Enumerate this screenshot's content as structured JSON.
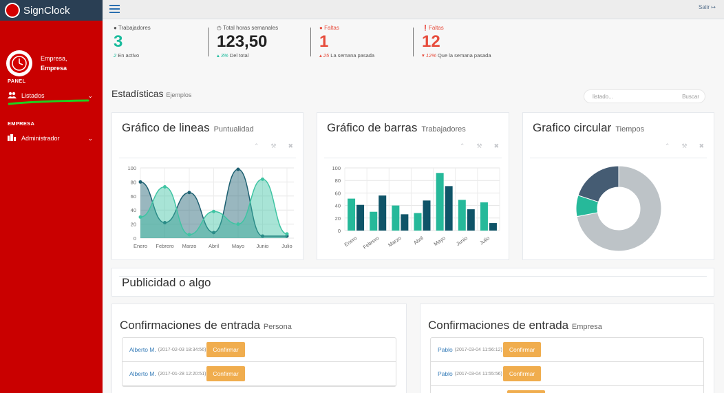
{
  "app": {
    "name": "SignClock"
  },
  "topbar": {
    "logout": "Salir"
  },
  "profile": {
    "greeting": "Empresa,",
    "name": "Empresa"
  },
  "sidebar": {
    "section_panel": "PANEL",
    "section_empresa": "EMPRESA",
    "items": [
      {
        "label": "Listados",
        "icon": "users-icon"
      },
      {
        "label": "Administrador",
        "icon": "building-icon"
      }
    ]
  },
  "stats": [
    {
      "label": "Trabajadores",
      "value": "3",
      "sub_value": "2",
      "sub_text": "En activo",
      "icon": "user-icon",
      "color": "#1abb9c"
    },
    {
      "label": "Total horas semanales",
      "value": "123,50",
      "sub_value": "3%",
      "sub_text": "Del total",
      "icon": "clock-icon",
      "color": "#222222"
    },
    {
      "label": "Faltas",
      "value": "1",
      "sub_value": "25",
      "sub_text": "La semana pasada",
      "icon": "user-icon",
      "color": "#e74c3c"
    },
    {
      "label": "Faltas",
      "value": "12",
      "sub_value": "12%",
      "sub_text": "Que la semana pasada",
      "icon": "exclamation-icon",
      "color": "#e74c3c"
    }
  ],
  "section": {
    "title": "Estadísticas",
    "subtitle": "Ejemplos"
  },
  "search": {
    "placeholder": "listado...",
    "button": "Buscar"
  },
  "panels": {
    "line": {
      "title": "Gráfico de lineas",
      "subtitle": "Puntualidad"
    },
    "bar": {
      "title": "Gráfico de barras",
      "subtitle": "Trabajadores"
    },
    "pie": {
      "title": "Grafico circular",
      "subtitle": "Tiempos"
    }
  },
  "ad": {
    "title": "Publicidad o algo"
  },
  "confirm_person": {
    "title": "Confirmaciones de entrada",
    "subtitle": "Persona",
    "rows": [
      {
        "name": "Alberto M.",
        "date": "(2017-02-03 18:34:56)",
        "button": "Confirmar"
      },
      {
        "name": "Alberto M.",
        "date": "(2017-01-28 12:20:51)",
        "button": "Confirmar"
      }
    ]
  },
  "confirm_company": {
    "title": "Confirmaciones de entrada",
    "subtitle": "Empresa",
    "rows": [
      {
        "name": "Pablo",
        "date": "(2017-03-04 11:56:12)",
        "button": "Confirmar"
      },
      {
        "name": "Pablo",
        "date": "(2017-03-04 11:55:56)",
        "button": "Confirmar"
      }
    ]
  },
  "chart_data": [
    {
      "type": "area",
      "categories": [
        "Enero",
        "Febrero",
        "Marzo",
        "Abril",
        "Mayo",
        "Junio",
        "Julio"
      ],
      "series": [
        {
          "values": [
            80,
            22,
            65,
            8,
            98,
            3,
            3
          ],
          "color": "#1d6071"
        },
        {
          "values": [
            30,
            73,
            5,
            38,
            20,
            84,
            6
          ],
          "color": "#3fc4a3"
        }
      ],
      "ylim": [
        0,
        100
      ],
      "yticks": [
        0,
        20,
        40,
        60,
        80,
        100
      ]
    },
    {
      "type": "bar",
      "categories": [
        "Enero",
        "Febrero",
        "Marzo",
        "Abril",
        "Mayo",
        "Junio",
        "Julio"
      ],
      "series": [
        {
          "values": [
            51,
            30,
            40,
            28,
            92,
            49,
            45
          ],
          "color": "#26b99a"
        },
        {
          "values": [
            41,
            56,
            26,
            48,
            71,
            34,
            12
          ],
          "color": "#0f5468"
        }
      ],
      "ylim": [
        0,
        100
      ],
      "yticks": [
        0,
        20,
        40,
        60,
        80,
        100
      ]
    },
    {
      "type": "pie",
      "donut": true,
      "slices": [
        {
          "value": 72,
          "color": "#bdc3c7"
        },
        {
          "value": 8,
          "color": "#26b99a"
        },
        {
          "value": 20,
          "color": "#455c73"
        }
      ]
    }
  ]
}
